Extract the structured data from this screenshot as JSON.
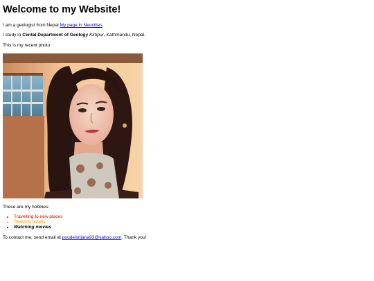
{
  "heading": "Welcome to my Website!",
  "intro": {
    "text": "I am a geologist from Nepal ",
    "link": "My page in Neocities",
    "after": "."
  },
  "study": {
    "prefix": "I study in ",
    "dept": "Cental Department of Geology",
    "space": " ",
    "place": "Kirtipur",
    "suffix": ", Kathmandu, Nepal."
  },
  "photo_caption": "This is my recent photo:",
  "hobbies_heading": "These are my hobbies:",
  "hobbies": [
    {
      "label": "Travelling to new places",
      "color": "#e00000"
    },
    {
      "label": "Reading novels",
      "color": "#ffa500"
    },
    {
      "label": "Watching movies",
      "color": "#000000"
    }
  ],
  "contact": {
    "prefix": "To contact me, send email at ",
    "email": "poudelsrijana93@yahoo.com",
    "suffix": ". Thank you!"
  }
}
